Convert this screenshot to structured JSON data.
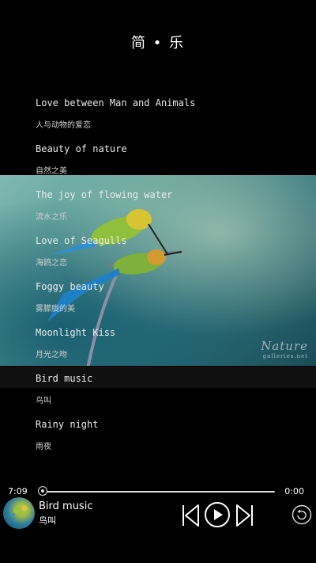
{
  "app": {
    "title": "简 • 乐"
  },
  "artwork": {
    "watermark_main": "Nature",
    "watermark_sub": "galleries.net"
  },
  "playlist": {
    "tracks": [
      {
        "title": "Love between Man and Animals",
        "subtitle": "人与动物的爱恋"
      },
      {
        "title": "Beauty of nature",
        "subtitle": "自然之美"
      },
      {
        "title": "The joy of flowing water",
        "subtitle": "流水之乐"
      },
      {
        "title": "Love of Seagulls",
        "subtitle": "海鸥之恋"
      },
      {
        "title": "Foggy beauty",
        "subtitle": "雾朦胧的美"
      },
      {
        "title": "Moonlight Kiss",
        "subtitle": "月光之吻"
      },
      {
        "title": "Bird music",
        "subtitle": "鸟叫"
      },
      {
        "title": "Rainy night",
        "subtitle": "雨夜"
      }
    ],
    "active_index": 6
  },
  "player": {
    "elapsed": "7:09",
    "duration": "0:00",
    "progress": 0,
    "now_playing_title": "Bird music",
    "now_playing_subtitle": "鸟叫",
    "icons": [
      "previous-icon",
      "play-icon",
      "next-icon",
      "repeat-icon"
    ],
    "colors": {
      "background": "#000000",
      "text": "#ffffff",
      "active_row": "#141414"
    }
  }
}
